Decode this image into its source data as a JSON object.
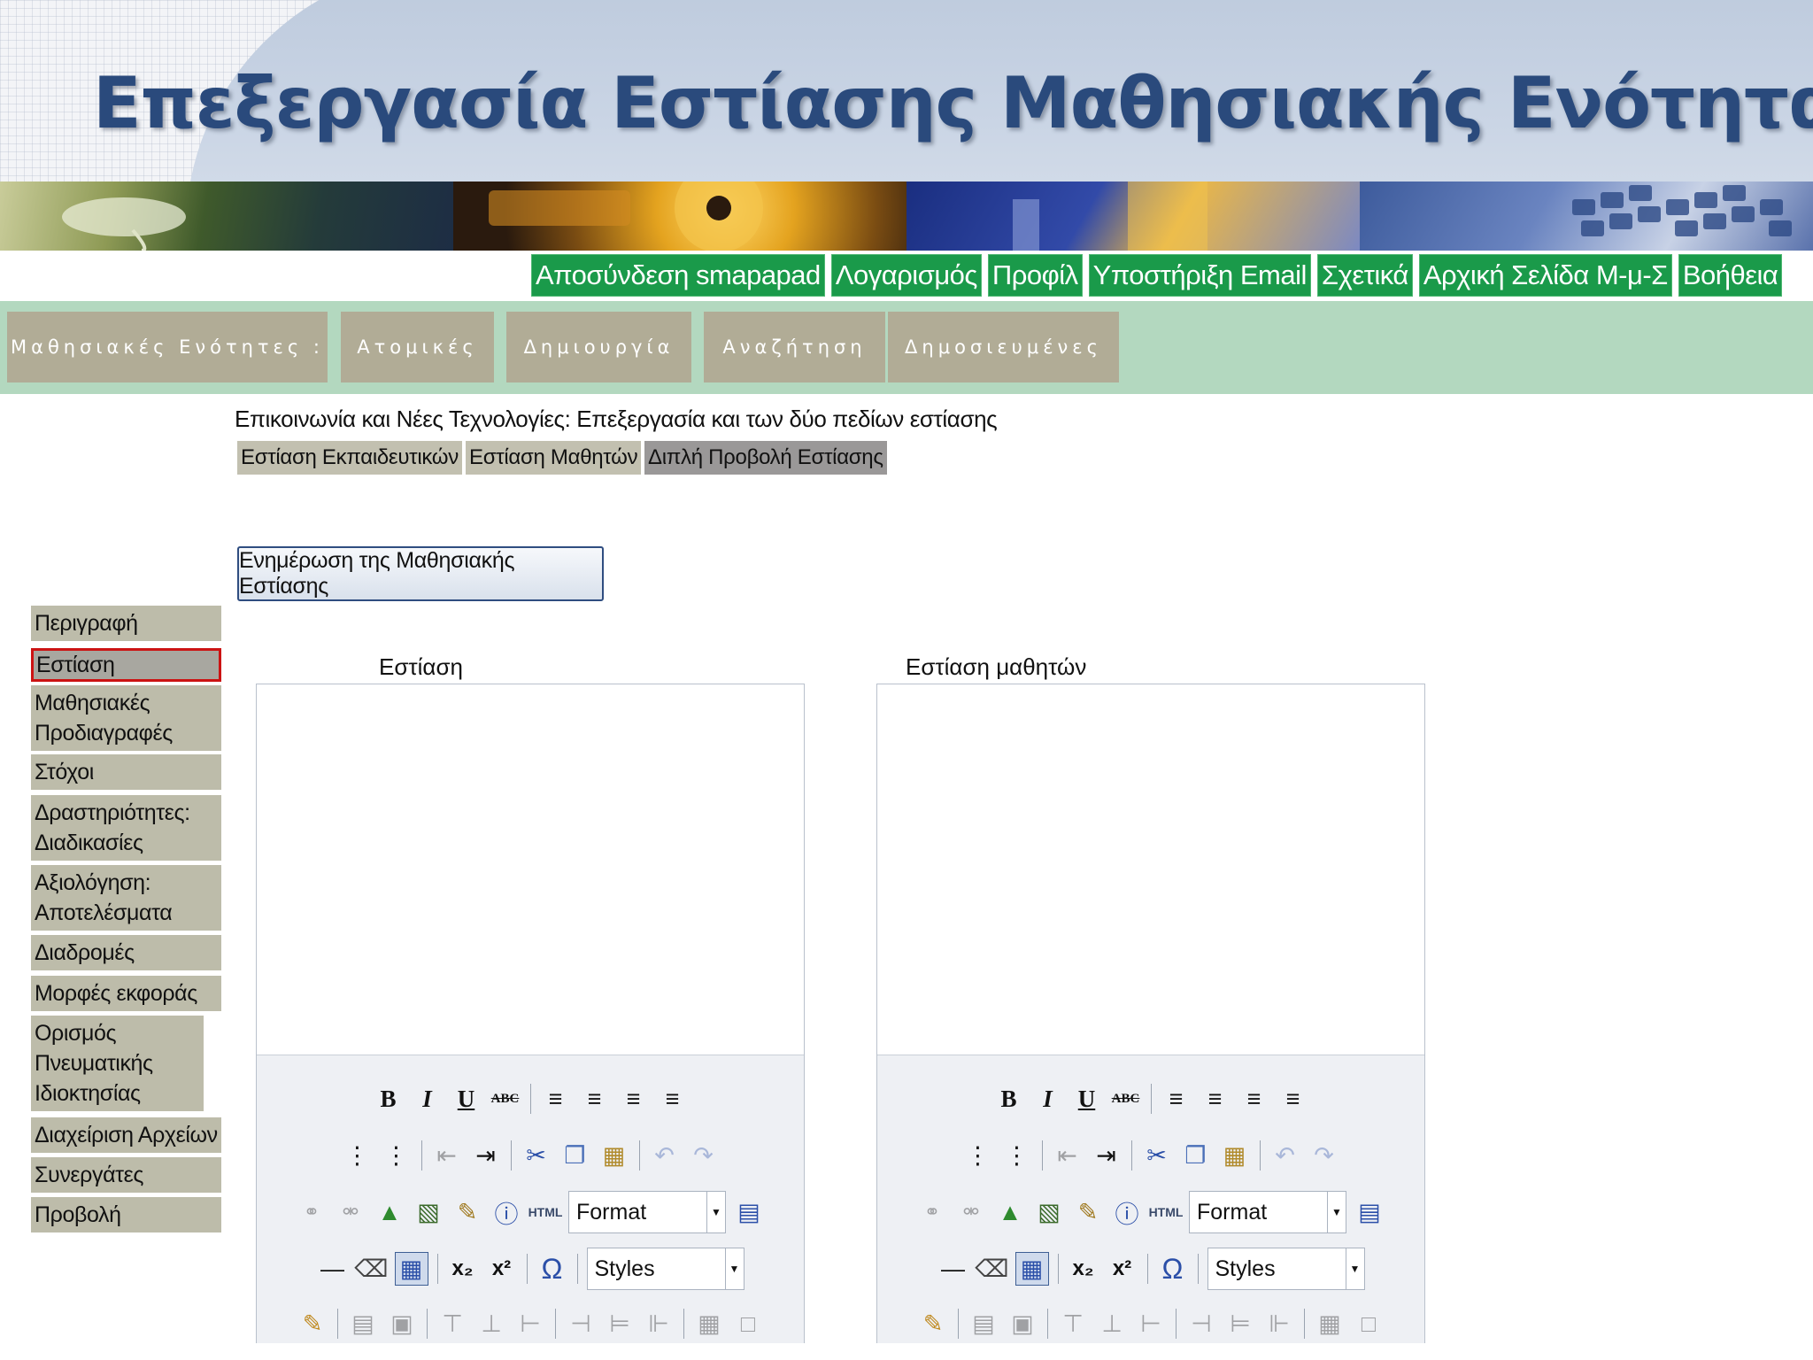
{
  "slide_title": "Επεξεργασία Εστίασης Μαθησιακής Ενότητας",
  "top_nav": [
    "Αποσύνδεση smapapad",
    "Λογαρισμός",
    "Προφίλ",
    "Υποστήριξη Email",
    "Σχετικά",
    "Αρχική Σελίδα Μ-μ-Σ",
    "Βοήθεια"
  ],
  "menu": {
    "label": "Μαθησιακές Ενότητες :",
    "items": [
      "Ατομικές",
      "Δημιουργία",
      "Αναζήτηση",
      "Δημοσιευμένες"
    ]
  },
  "breadcrumb": "Επικοινωνία και Νέες Τεχνολογίες: Επεξεργασία και των δύο πεδίων εστίασης",
  "focus_tabs": [
    "Εστίαση Εκπαιδευτικών",
    "Εστίαση Μαθητών",
    "Διπλή Προβολή Εστίασης"
  ],
  "active_focus_tab": "Διπλή Προβολή Εστίασης",
  "update_button": "Ενημέρωση της Μαθησιακής Εστίασης",
  "sidebar": [
    "Περιγραφή",
    "Εστίαση",
    "Μαθησιακές Προδιαγραφές",
    "Στόχοι",
    "Δραστηριότητες: Διαδικασίες",
    "Αξιολόγηση: Αποτελέσματα",
    "Διαδρομές",
    "Μορφές εκφοράς",
    "Ορισμός Πνευματικής Ιδιοκτησίας",
    "Διαχείριση Αρχείων",
    "Συνεργάτες",
    "Προβολή"
  ],
  "sidebar_active": "Εστίαση",
  "editors": [
    {
      "label": "Εστίαση",
      "format": "Format",
      "styles": "Styles",
      "html_label": "HTML",
      "bold": "B",
      "italic": "I",
      "underline": "U",
      "strike": "ABC"
    },
    {
      "label": "Εστίαση μαθητών",
      "format": "Format",
      "styles": "Styles",
      "html_label": "HTML",
      "bold": "B",
      "italic": "I",
      "underline": "U",
      "strike": "ABC"
    }
  ],
  "colors": {
    "accent_green": "#1a9a4a",
    "menu_bg": "#b3d8bf",
    "menu_btn": "#b1ac96",
    "sidebar_item": "#bdbcaa",
    "active_border": "#cc1313",
    "title": "#2a4a7c"
  }
}
